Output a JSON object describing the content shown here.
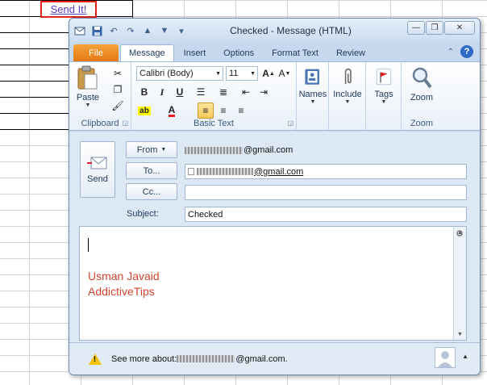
{
  "spreadsheet": {
    "send_link": "Send It!"
  },
  "window": {
    "title": "Checked  -  Message (HTML)",
    "qat": [
      "save-icon",
      "undo-icon",
      "redo-icon",
      "up-icon",
      "down-icon"
    ]
  },
  "tabs": [
    "File",
    "Message",
    "Insert",
    "Options",
    "Format Text",
    "Review"
  ],
  "ribbon": {
    "clipboard": {
      "label": "Clipboard",
      "paste": "Paste"
    },
    "basic_text": {
      "label": "Basic Text",
      "font": "Calibri (Body)",
      "size": "11"
    },
    "names": "Names",
    "include": "Include",
    "tags": "Tags",
    "zoom_btn": "Zoom",
    "zoom_label": "Zoom"
  },
  "compose": {
    "send": "Send",
    "from_btn": "From",
    "from_value": "@gmail.com",
    "to_btn": "To...",
    "to_value": "@gmail.com",
    "cc_btn": "Cc...",
    "cc_value": "",
    "subject_label": "Subject:",
    "subject_value": "Checked"
  },
  "body": {
    "line1": "Usman Javaid",
    "line2": "AddictiveTips"
  },
  "people_pane": {
    "prefix": "See more about: ",
    "email": "@gmail.com."
  }
}
